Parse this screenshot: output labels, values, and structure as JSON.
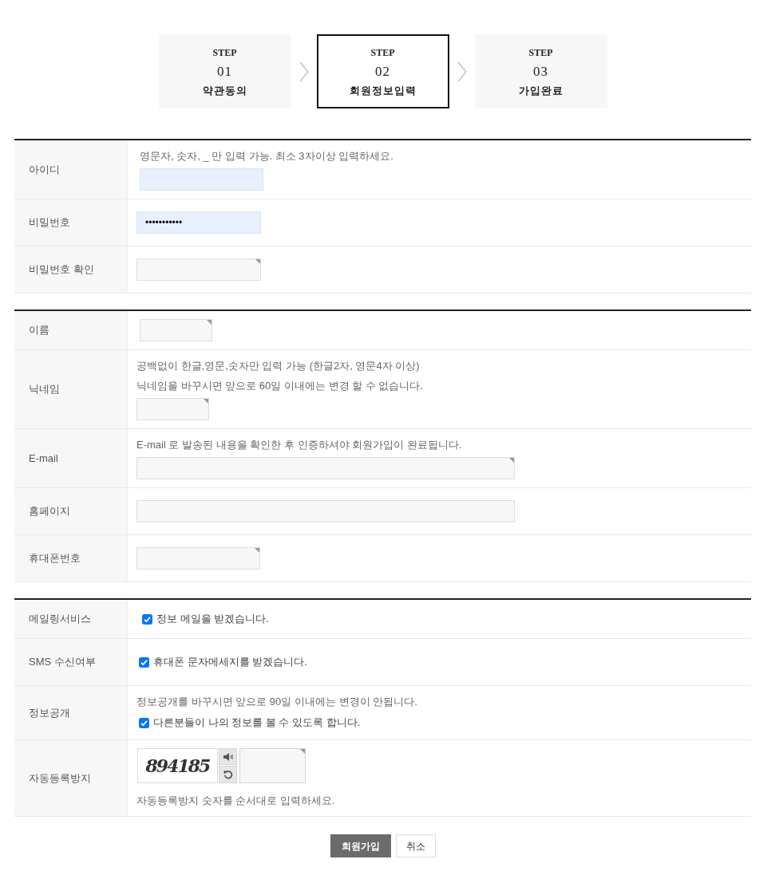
{
  "steps": [
    {
      "label": "STEP",
      "number": "01",
      "title": "약관동의",
      "selected": false
    },
    {
      "label": "STEP",
      "number": "02",
      "title": "회원정보입력",
      "selected": true
    },
    {
      "label": "STEP",
      "number": "03",
      "title": "가입완료",
      "selected": false
    }
  ],
  "sections": [
    {
      "rows": [
        {
          "label": "아이디",
          "items": [
            {
              "kind": "help",
              "text": "영문자, 숫자, _ 만 입력 가능. 최소 3자이상 입력하세요."
            },
            {
              "kind": "userid",
              "autofilled": true
            }
          ]
        },
        {
          "label": "비밀번호",
          "items": [
            {
              "kind": "password",
              "value": "•••••••••••",
              "autofilled": true
            }
          ]
        },
        {
          "label": "비밀번호 확인",
          "items": [
            {
              "kind": "password",
              "autofilled": false,
              "required_mark": true
            }
          ]
        }
      ]
    },
    {
      "rows": [
        {
          "label": "이름",
          "items": [
            {
              "kind": "name",
              "autofilled": false,
              "required_mark": true
            }
          ]
        },
        {
          "label": "닉네임",
          "items": [
            {
              "kind": "help",
              "text": "공백없이 한글,영문,숫자만 입력 가능 (한글2자, 영문4자 이상)"
            },
            {
              "kind": "help",
              "text": "닉네임을 바꾸시면 앞으로 60일 이내에는 변경 할 수 없습니다."
            },
            {
              "kind": "nickname",
              "autofilled": false,
              "required_mark": true
            }
          ]
        },
        {
          "label": "E-mail",
          "items": [
            {
              "kind": "help",
              "text": "E-mail 로 발송된 내용을 확인한 후 인증하셔야 회원가입이 완료됩니다."
            },
            {
              "kind": "email",
              "autofilled": false,
              "required_mark": true
            }
          ]
        },
        {
          "label": "홈페이지",
          "items": [
            {
              "kind": "url",
              "autofilled": false
            }
          ]
        },
        {
          "label": "휴대폰번호",
          "items": [
            {
              "kind": "tel",
              "autofilled": false,
              "required_mark": true
            }
          ]
        }
      ]
    },
    {
      "rows": [
        {
          "label": "메일링서비스",
          "items": [
            {
              "kind": "checkbox",
              "text": "정보 메일을 받겠습니다.",
              "checked": true
            }
          ]
        },
        {
          "label": "SMS 수신여부",
          "items": [
            {
              "kind": "checkbox",
              "text": "휴대폰 문자메세지를 받겠습니다.",
              "checked": true
            }
          ]
        },
        {
          "label": "정보공개",
          "items": [
            {
              "kind": "help",
              "text": "정보공개를 바꾸시면 앞으로 90일 이내에는 변경이 안됩니다."
            },
            {
              "kind": "checkbox",
              "text": "다른분들이 나의 정보를 볼 수 있도록 합니다.",
              "checked": true
            }
          ]
        },
        {
          "label": "자동등록방지",
          "items": [
            {
              "kind": "captcha",
              "code": "894185",
              "required_mark": true
            },
            {
              "kind": "help",
              "text": "자동등록방지 숫자를 순서대로 입력하세요."
            }
          ]
        }
      ]
    }
  ],
  "buttons": [
    {
      "label": "회원가입",
      "kind": "primary"
    },
    {
      "label": "취소",
      "kind": "secondary"
    }
  ]
}
